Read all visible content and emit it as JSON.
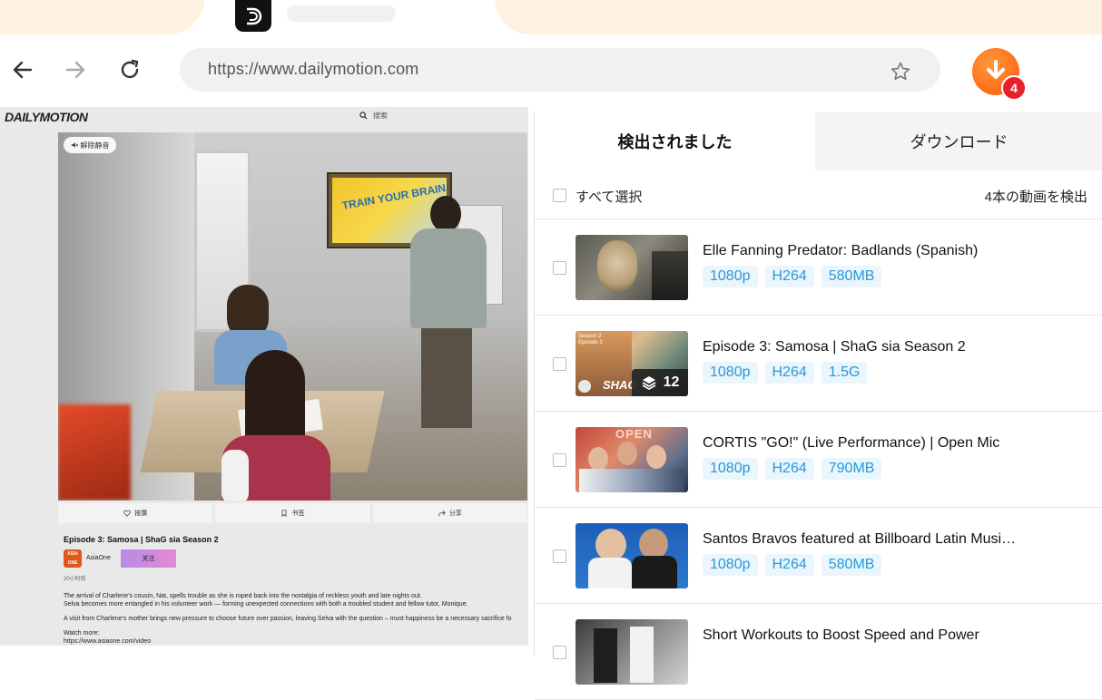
{
  "browser": {
    "url": "https://www.dailymotion.com",
    "extension_badge_count": "4"
  },
  "page": {
    "site_logo": "DAILYMOTION",
    "search_placeholder": "搜索",
    "mute_label": "解除静音",
    "board_text": "TRAIN YOUR BRAIN",
    "actions": [
      {
        "label": "按讚",
        "icon": "heart-icon"
      },
      {
        "label": "书签",
        "icon": "bookmark-icon"
      },
      {
        "label": "分享",
        "icon": "share-icon"
      }
    ],
    "video_title": "Episode 3: Samosa | ShaG sia Season 2",
    "channel_name": "AsiaOne",
    "channel_avatar_text": "ASIA ONE",
    "follow_label": "关注",
    "time_ago": "20小时前",
    "description": [
      "The arrival of Charlene's cousin, Nat, spells trouble as she is roped back into the nostalgia of reckless youth and late nights out.",
      "Selva becomes more entangled in his volunteer work — forming unexpected connections with both a troubled student and fellow tutor, Monique.",
      "A visit from Charlene's mother brings new pressure to choose future over passion, leaving Selva with the question – must happiness be a necessary sacrifice fo",
      "Watch more:",
      "https://www.asiaone.com/video"
    ]
  },
  "panel": {
    "tabs": {
      "detected": "検出されました",
      "download": "ダウンロード"
    },
    "select_all": "すべて選択",
    "detected_count": "4本の動画を検出",
    "items": [
      {
        "title": "Elle Fanning Predator: Badlands (Spanish)",
        "tags": [
          "1080p",
          "H264",
          "580MB"
        ]
      },
      {
        "title": "Episode 3: Samosa | ShaG sia Season 2",
        "tags": [
          "1080p",
          "H264",
          "1.5G"
        ],
        "playlist_count": "12",
        "thumb_caption": "SHAG",
        "thumb_small": "Season 2 Episode 3"
      },
      {
        "title": "CORTIS \"GO!\" (Live Performance) | Open Mic",
        "tags": [
          "1080p",
          "H264",
          "790MB"
        ],
        "thumb_caption": "OPEN"
      },
      {
        "title": "Santos Bravos featured at Billboard Latin Musi…",
        "tags": [
          "1080p",
          "H264",
          "580MB"
        ]
      },
      {
        "title": "Short Workouts to Boost Speed and Power",
        "tags": []
      }
    ]
  },
  "colors": {
    "accent_orange": "#ff7a1f",
    "badge_red": "#e8202a",
    "tag_text": "#2799d8",
    "tag_bg": "#eaf5fc"
  }
}
